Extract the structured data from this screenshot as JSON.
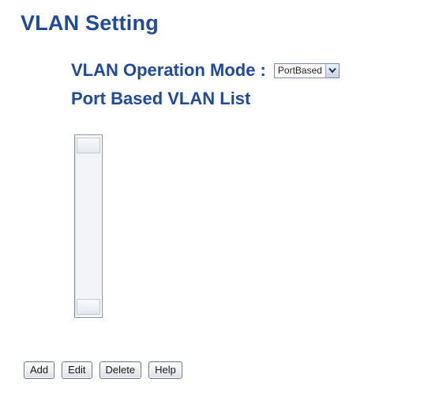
{
  "page": {
    "title": "VLAN Setting"
  },
  "mode": {
    "label": "VLAN Operation Mode :",
    "selected": "PortBased"
  },
  "vlan_list": {
    "title": "Port Based VLAN List",
    "items": []
  },
  "buttons": {
    "add": "Add",
    "edit": "Edit",
    "delete": "Delete",
    "help": "Help"
  },
  "colors": {
    "heading": "#1f4aa0"
  },
  "icons": {
    "dropdown": "chevron-down-icon"
  }
}
